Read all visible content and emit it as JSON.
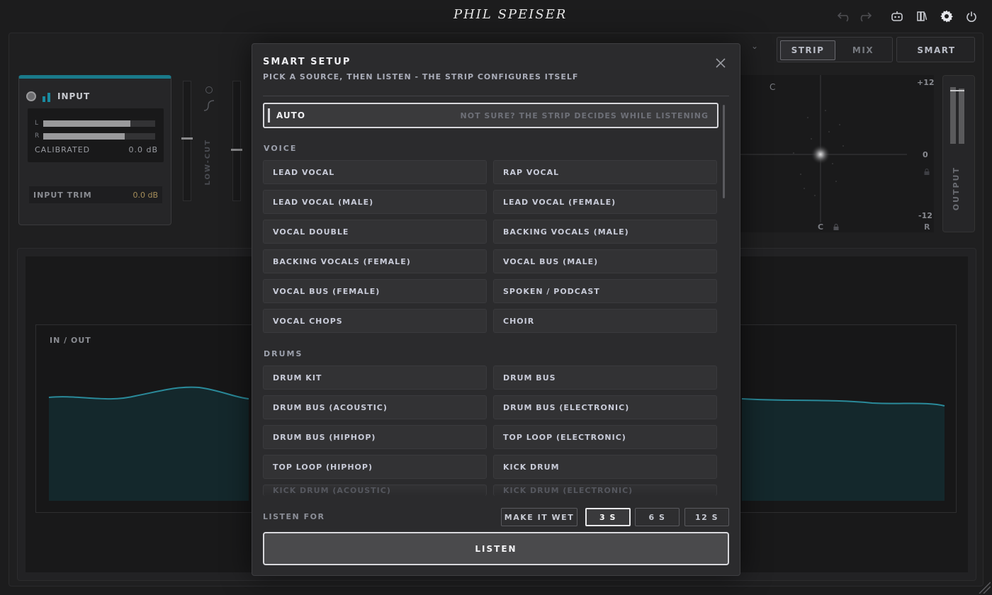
{
  "app": {
    "logo": "PHIL SPEISER",
    "toolbar_icons": [
      "undo-icon",
      "redo-icon",
      "robot-icon",
      "library-icon",
      "gear-icon",
      "power-icon"
    ]
  },
  "header": {
    "modes": [
      "STRIP",
      "MIX"
    ],
    "active_mode": "STRIP",
    "smart_label": "SMART"
  },
  "input_panel": {
    "title": "INPUT",
    "meter_left_label": "L",
    "meter_right_label": "R",
    "meter_left_level": 0.78,
    "meter_right_level": 0.73,
    "calibrated_label": "CALIBRATED",
    "calibrated_value": "0.0 dB",
    "trim_label": "INPUT TRIM",
    "trim_value": "0.0 dB"
  },
  "faders": {
    "lowcut_label": "LOW-CUT"
  },
  "scope": {
    "top_label": "C",
    "bottom_label": "C",
    "right_label": "R",
    "scale_top": "+12",
    "scale_mid": "0",
    "scale_bottom": "-12"
  },
  "output": {
    "label": "OUTPUT"
  },
  "graph": {
    "label": "IN / OUT"
  },
  "modal": {
    "title": "SMART SETUP",
    "subtitle": "PICK A SOURCE, THEN LISTEN - THE STRIP CONFIGURES ITSELF",
    "auto": {
      "label": "AUTO",
      "hint": "NOT SURE? THE STRIP DECIDES WHILE LISTENING"
    },
    "sections": [
      {
        "label": "VOICE",
        "items": [
          "LEAD VOCAL",
          "RAP VOCAL",
          "LEAD VOCAL (MALE)",
          "LEAD VOCAL (FEMALE)",
          "VOCAL DOUBLE",
          "BACKING VOCALS (MALE)",
          "BACKING VOCALS (FEMALE)",
          "VOCAL BUS (MALE)",
          "VOCAL BUS (FEMALE)",
          "SPOKEN / PODCAST",
          "VOCAL CHOPS",
          "CHOIR"
        ]
      },
      {
        "label": "DRUMS",
        "items": [
          "DRUM KIT",
          "DRUM BUS",
          "DRUM BUS (ACOUSTIC)",
          "DRUM BUS (ELECTRONIC)",
          "DRUM BUS (HIPHOP)",
          "TOP LOOP (ELECTRONIC)",
          "TOP LOOP (HIPHOP)",
          "KICK DRUM",
          "KICK DRUM (ACOUSTIC)",
          "KICK DRUM (ELECTRONIC)"
        ]
      }
    ],
    "listen_for_label": "LISTEN FOR",
    "make_wet_label": "MAKE IT WET",
    "durations": [
      "3 S",
      "6 S",
      "12 S"
    ],
    "active_duration": "3 S",
    "listen_label": "LISTEN"
  }
}
